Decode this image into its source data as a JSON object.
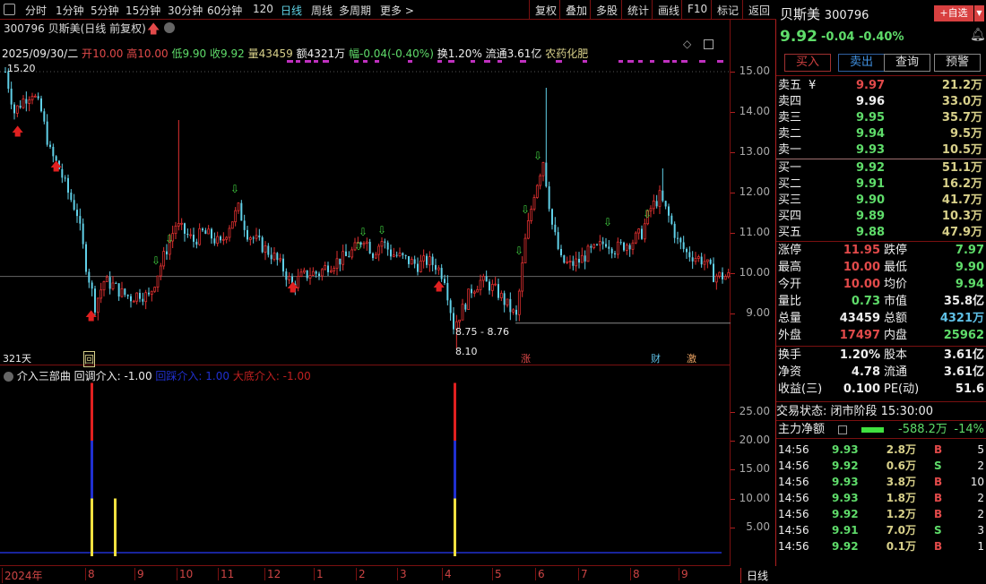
{
  "toolbar": {
    "periods": [
      "分时",
      "1分钟",
      "5分钟",
      "15分钟",
      "30分钟",
      "60分钟",
      "120",
      "日线",
      "周线",
      "多周期",
      "更多 >"
    ],
    "active": "日线",
    "actions": [
      "复权",
      "叠加",
      "多股",
      "统计",
      "画线",
      "F10",
      "标记",
      "返回"
    ]
  },
  "chart_header": {
    "title": "300796 贝斯美(日线 前复权)",
    "date": "2025/09/30/二",
    "open_label": "开",
    "open": "10.00",
    "high_label": "高",
    "high": "10.00",
    "low_label": "低",
    "low": "9.90",
    "close_label": "收",
    "close": "9.92",
    "vol_label": "量",
    "vol": "43459",
    "amt_label": "额",
    "amt": "4321万",
    "chg_label": "幅",
    "chg": "-0.04(-0.40%)",
    "turn": "换1.20%",
    "float": "流通3.61亿",
    "sector": "农药化肥"
  },
  "annotations": {
    "max": "15.20",
    "range": "8.75 - 8.76",
    "min": "8.10",
    "days": "321天",
    "mark_hui": "回",
    "mark_zhang": "涨",
    "mark_cai": "财",
    "mark_ji": "激"
  },
  "price_axis": [
    "15.00",
    "14.00",
    "13.00",
    "12.00",
    "11.00",
    "10.00",
    "9.00"
  ],
  "indicator": {
    "name": "介入三部曲",
    "l1": "回调介入: -1.00",
    "l2": "回踩介入: 1.00",
    "l3": "大底介入: -1.00",
    "axis": [
      "25.00",
      "20.00",
      "15.00",
      "10.00",
      "5.00"
    ],
    "colors": {
      "yellow": "#f0e040",
      "blue": "#2030d0",
      "red": "#e02020"
    }
  },
  "date_axis": [
    "2024年",
    "8",
    "9",
    "10",
    "11",
    "12",
    "1",
    "2",
    "3",
    "4",
    "5",
    "6",
    "7",
    "8",
    "9"
  ],
  "date_axis_mode": "日线",
  "chart_data": {
    "type": "candlestick",
    "ylim": [
      8,
      15.5
    ],
    "closes": [
      15.0,
      14.0,
      14.3,
      14.5,
      14.0,
      13.0,
      12.6,
      12.0,
      11.5,
      10.2,
      9.2,
      9.8,
      9.7,
      9.5,
      9.4,
      9.5,
      9.4,
      10.0,
      10.6,
      11.2,
      11.0,
      10.8,
      11.0,
      10.9,
      10.7,
      11.2,
      11.6,
      11.0,
      10.8,
      10.6,
      10.4,
      10.1,
      9.7,
      9.9,
      10.0,
      10.0,
      10.2,
      10.3,
      10.4,
      10.6,
      10.9,
      10.5,
      10.8,
      10.5,
      10.4,
      10.3,
      10.2,
      10.3,
      10.2,
      9.9,
      8.7,
      9.1,
      9.6,
      9.8,
      9.7,
      9.5,
      9.2,
      8.9,
      10.8,
      12.0,
      12.8,
      11.2,
      10.3,
      10.2,
      10.3,
      10.5,
      10.6,
      10.8,
      10.6,
      10.7,
      10.8,
      11.0,
      11.6,
      11.9,
      11.4,
      10.8,
      10.5,
      10.4,
      10.3,
      9.95,
      9.92
    ],
    "spikes": [
      {
        "index": 19,
        "high": 13.8
      },
      {
        "index": 60,
        "high": 14.6
      },
      {
        "index": 73,
        "high": 12.6
      },
      {
        "index": 50,
        "low": 8.1
      }
    ],
    "indicator_bars": [
      {
        "pos": "2024-08",
        "value": 30
      },
      {
        "pos": "2024-08b",
        "value": 10
      },
      {
        "pos": "2025-04",
        "value": 30
      }
    ]
  },
  "quote": {
    "name": "贝斯美",
    "code": "300796",
    "add_btn": "+自选",
    "price": "9.92",
    "chg": "-0.04",
    "pct": "-0.40%",
    "buttons": [
      "买入",
      "卖出",
      "查询",
      "预警"
    ]
  },
  "book": {
    "sell": [
      {
        "l": "卖五",
        "p": "9.97",
        "v": "21.2万"
      },
      {
        "l": "卖四",
        "p": "9.96",
        "v": "33.0万"
      },
      {
        "l": "卖三",
        "p": "9.95",
        "v": "35.7万"
      },
      {
        "l": "卖二",
        "p": "9.94",
        "v": "9.5万"
      },
      {
        "l": "卖一",
        "p": "9.93",
        "v": "10.5万"
      }
    ],
    "buy": [
      {
        "l": "买一",
        "p": "9.92",
        "v": "51.1万"
      },
      {
        "l": "买二",
        "p": "9.91",
        "v": "16.2万"
      },
      {
        "l": "买三",
        "p": "9.90",
        "v": "41.7万"
      },
      {
        "l": "买四",
        "p": "9.89",
        "v": "10.3万"
      },
      {
        "l": "买五",
        "p": "9.88",
        "v": "47.9万"
      }
    ]
  },
  "stats": [
    [
      "涨停",
      "11.95",
      "r",
      "跌停",
      "7.97",
      "g"
    ],
    [
      "最高",
      "10.00",
      "r",
      "最低",
      "9.90",
      "g"
    ],
    [
      "今开",
      "10.00",
      "r",
      "均价",
      "9.94",
      "g"
    ],
    [
      "量比",
      "0.73",
      "g",
      "市值",
      "35.8亿",
      "w"
    ],
    [
      "总量",
      "43459",
      "w",
      "总额",
      "4321万",
      "c"
    ],
    [
      "外盘",
      "17497",
      "r",
      "内盘",
      "25962",
      "g"
    ]
  ],
  "stats2": [
    [
      "换手",
      "1.20%",
      "股本",
      "3.61亿"
    ],
    [
      "净资",
      "4.78",
      "流通",
      "3.61亿"
    ],
    [
      "收益(三)",
      "0.100",
      "PE(动)",
      "51.6"
    ]
  ],
  "status": {
    "label": "交易状态: 闭市阶段",
    "time": "15:30:00"
  },
  "main_flow": {
    "label": "主力净额",
    "value": "-588.2万",
    "pct": "-14%"
  },
  "trades": [
    [
      "14:56",
      "9.93",
      "2.8万",
      "B",
      "5"
    ],
    [
      "14:56",
      "9.92",
      "0.6万",
      "S",
      "2"
    ],
    [
      "14:56",
      "9.93",
      "3.8万",
      "B",
      "10"
    ],
    [
      "14:56",
      "9.93",
      "1.8万",
      "B",
      "2"
    ],
    [
      "14:56",
      "9.92",
      "1.2万",
      "B",
      "2"
    ],
    [
      "14:56",
      "9.91",
      "7.0万",
      "S",
      "3"
    ],
    [
      "14:56",
      "9.92",
      "0.1万",
      "B",
      "1"
    ]
  ]
}
